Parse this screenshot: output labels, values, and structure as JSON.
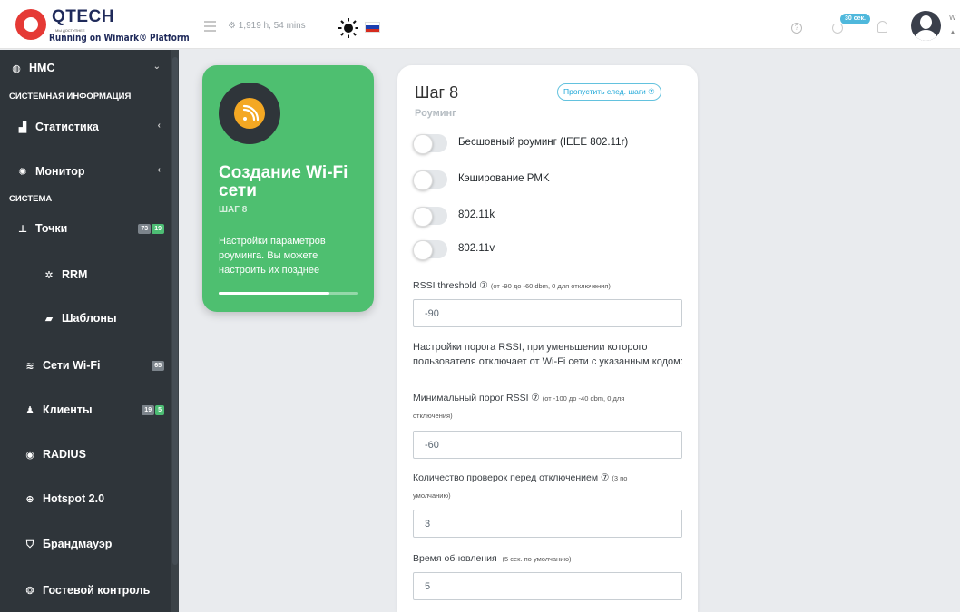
{
  "header": {
    "logo_text": "QTECH",
    "logo_sub": "МЫ ДОСТУПНЕЕ",
    "logo_tag": "Running on Wimark® Platform",
    "uptime": "⚙ 1,919 h, 54 mins",
    "refresh_badge": "30 сек.",
    "user_line1": "W",
    "user_line2": "▲"
  },
  "sidebar": {
    "items": [
      {
        "label": "НМС",
        "icon": "globe-icon"
      },
      {
        "label": "Статистика",
        "icon": "bar-chart-icon"
      },
      {
        "label": "Монитор",
        "icon": "monitor-icon"
      },
      {
        "label": "Точки",
        "icon": "access-point-icon",
        "badges": [
          "73",
          "19"
        ]
      },
      {
        "label": "RRM",
        "icon": "rrm-icon"
      },
      {
        "label": "Шаблоны",
        "icon": "templates-icon"
      },
      {
        "label": "Сети Wi-Fi",
        "icon": "wifi-icon",
        "badges": [
          "65"
        ]
      },
      {
        "label": "Клиенты",
        "icon": "user-icon",
        "badges": [
          "19",
          "5"
        ]
      },
      {
        "label": "RADIUS",
        "icon": "radius-icon"
      },
      {
        "label": "Hotspot 2.0",
        "icon": "hotspot-icon"
      },
      {
        "label": "Брандмауэр",
        "icon": "shield-icon"
      },
      {
        "label": "Гостевой контроль",
        "icon": "guest-icon"
      }
    ],
    "sections": [
      "СИСТЕМНАЯ ИНФОРМАЦИЯ",
      "СИСТЕМА"
    ]
  },
  "wizard_card": {
    "title": "Создание Wi-Fi сети",
    "step": "ШАГ 8",
    "description": "Настройки параметров роуминга. Вы можете настроить их позднее",
    "progress_fraction": 0.8
  },
  "form": {
    "title": "Шаг 8",
    "subtitle": "Роуминг",
    "skip_label": "Пропустить след. шаги ⑦",
    "toggles": [
      {
        "label": "Бесшовный роуминг (IEEE 802.11r)",
        "on": false
      },
      {
        "label": "Кэширование PMK",
        "on": false
      },
      {
        "label": "802.11k",
        "on": false
      },
      {
        "label": "802.11v",
        "on": false
      }
    ],
    "rssi_label": "RSSI threshold ⑦",
    "rssi_hint": "(от -90 до -60 dbm, 0 для отключения)",
    "rssi_value": "-90",
    "rssi_desc": "Настройки порога RSSI, при уменьшении которого пользователя отключает от Wi-Fi сети с указанным кодом:",
    "min_label": "Минимальный порог RSSI ⑦",
    "min_hint_1": "(от -100 до -40 dbm, 0 для",
    "min_hint_2": "отключения)",
    "min_value": "-60",
    "checks_label": "Количество проверок перед отключением ⑦",
    "checks_hint_1": "(3 по",
    "checks_hint_2": "умолчанию)",
    "checks_value": "3",
    "update_label": "Время обновления",
    "update_hint": "(5 сек. по умолчанию)",
    "update_value": "5"
  },
  "colors": {
    "accent_green": "#4ebf70",
    "sidebar_bg": "#2f353a",
    "info_blue": "#20a8d8"
  }
}
